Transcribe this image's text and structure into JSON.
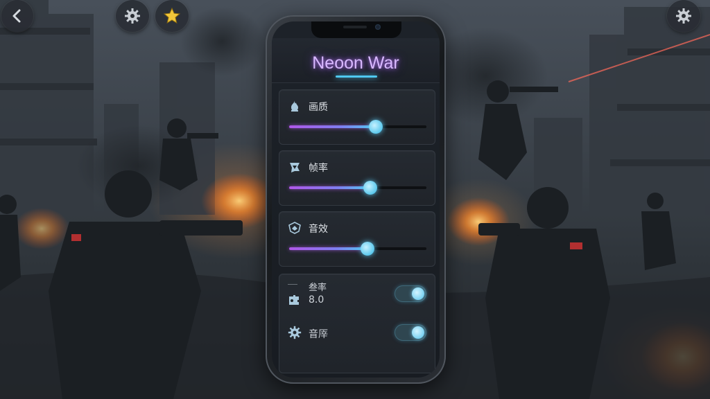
{
  "game": {
    "title": "Neoon War"
  },
  "hud": {
    "back_icon": "chevron-left-icon",
    "left_settings_icon": "gear-icon",
    "star_icon": "star-icon",
    "right_settings_icon": "gear-icon",
    "star_color": "#f2c73a"
  },
  "settings": {
    "sliders": [
      {
        "label": "画质",
        "icon": "flame-icon",
        "value": 0.63
      },
      {
        "label": "帧率",
        "icon": "emblem-icon",
        "value": 0.59
      },
      {
        "label": "音效",
        "icon": "shield-icon",
        "value": 0.57
      }
    ],
    "toggle_rows": [
      {
        "label": "叁率",
        "value": "8.0",
        "icon": "puzzle-icon",
        "on": true
      },
      {
        "label": "音厗",
        "icon": "gear-icon",
        "on": true
      }
    ]
  },
  "colors": {
    "title_glow": "#c88cff",
    "accent_cyan": "#52c8f0",
    "accent_purple": "#b057e8"
  }
}
